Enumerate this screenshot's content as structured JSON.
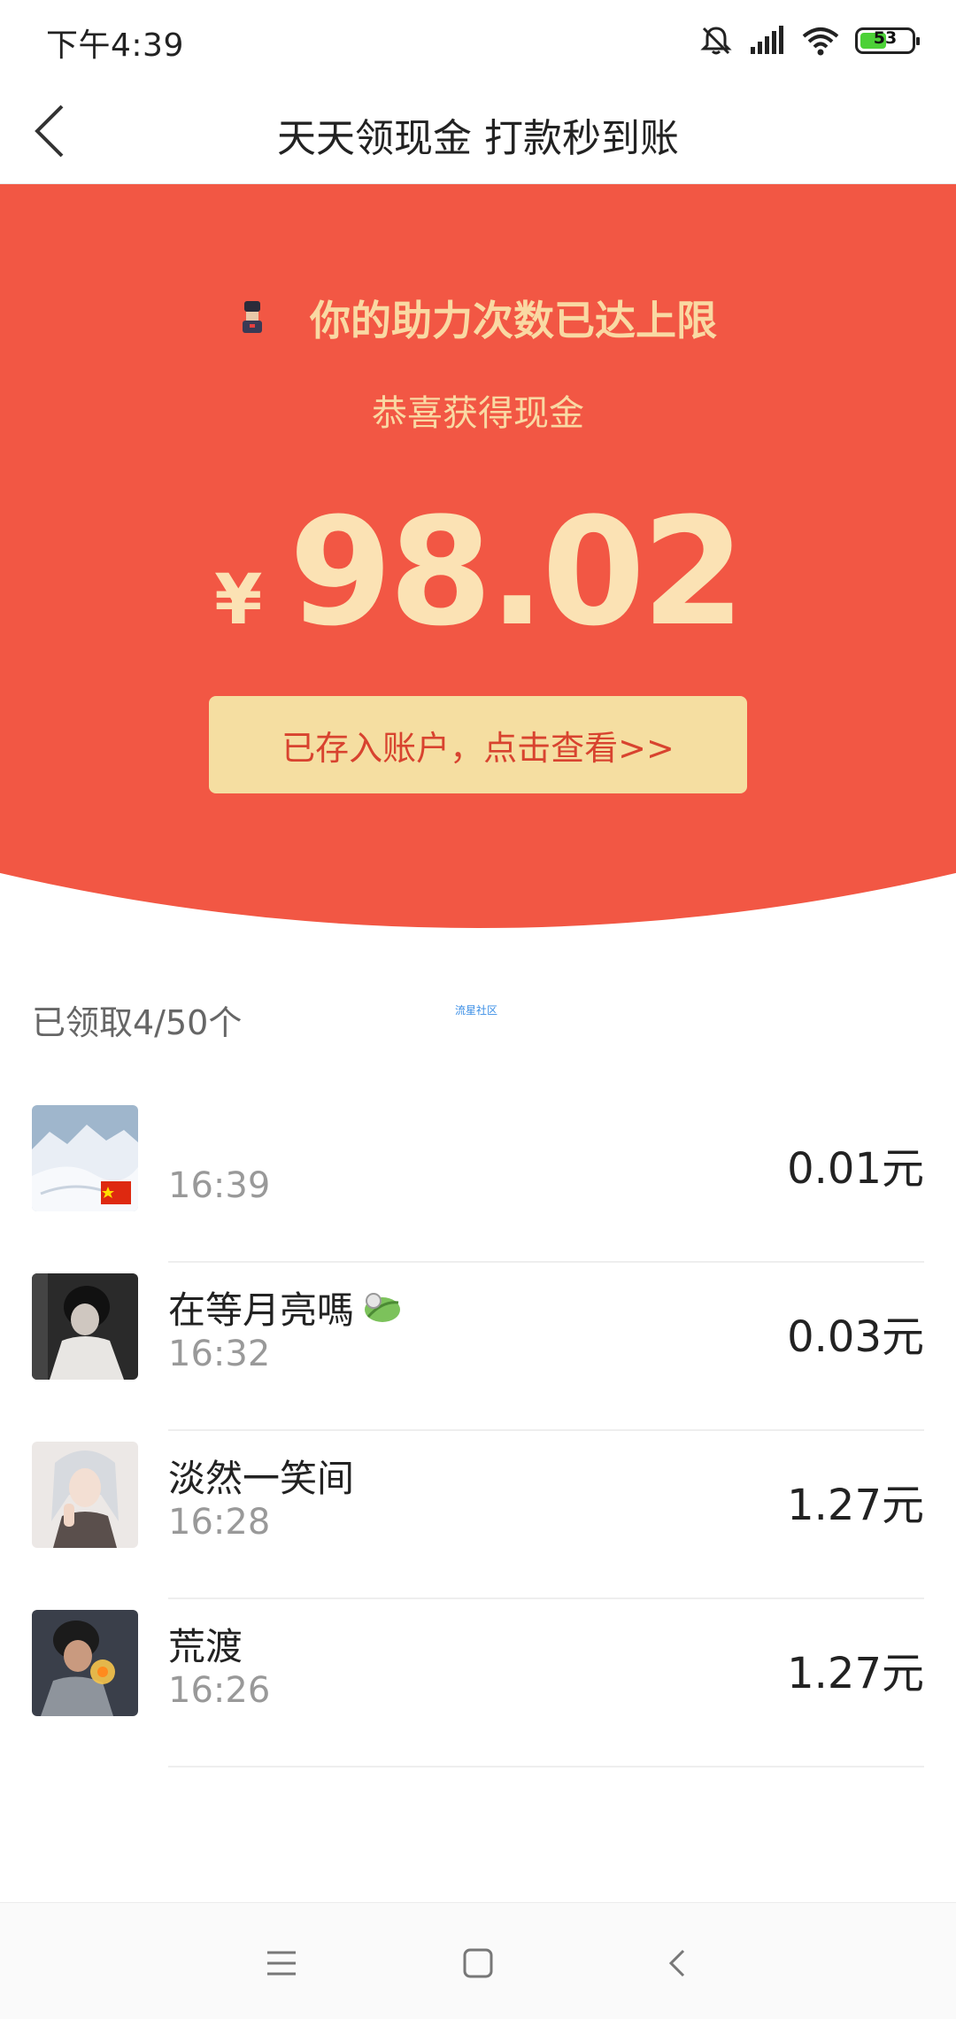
{
  "status_bar": {
    "time": "下午4:39",
    "battery": "53",
    "battery_level": 0.53,
    "icons": [
      "mute-icon",
      "signal-icon",
      "wifi-icon",
      "battery-icon"
    ]
  },
  "nav": {
    "title": "天天领现金 打款秒到账",
    "back_icon": "chevron-left-icon"
  },
  "hero": {
    "limit_text": "你的助力次数已达上限",
    "congrats": "恭喜获得现金",
    "currency": "¥",
    "amount": "98.02",
    "button_label": "已存入账户，点击查看>>",
    "colors": {
      "background": "#f25744",
      "text": "#f9d9a3",
      "button": "#f5dea1",
      "button_text": "#d8432f"
    }
  },
  "list": {
    "header": "已领取4/50个",
    "watermark": "流星社区",
    "records": [
      {
        "name": "",
        "time": "16:39",
        "amount": "0.01元",
        "avatar": "snow-landscape-avatar",
        "badge": "china-flag-icon"
      },
      {
        "name": "在等月亮嗎",
        "time": "16:32",
        "amount": "0.03元",
        "avatar": "person-photo-avatar",
        "emoji": "leaf-emoji-icon"
      },
      {
        "name": "淡然一笑间",
        "time": "16:28",
        "amount": "1.27元",
        "avatar": "anime-character-avatar"
      },
      {
        "name": "荒渡",
        "time": "16:26",
        "amount": "1.27元",
        "avatar": "illustration-avatar"
      }
    ]
  },
  "bottom_nav": {
    "items": [
      "menu-icon",
      "home-icon",
      "back-icon"
    ]
  }
}
